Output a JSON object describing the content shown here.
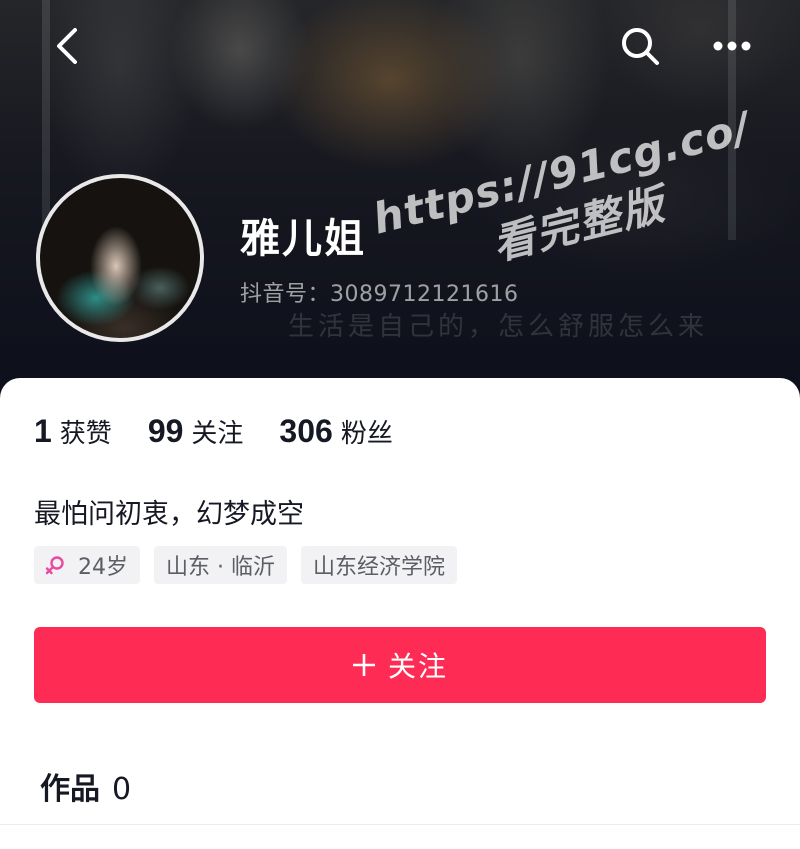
{
  "header": {
    "icons": {
      "back": "chevron-left-icon",
      "search": "search-icon",
      "more": "more-dots-icon"
    }
  },
  "profile": {
    "nickname": "雅儿姐",
    "douyin_id": "抖音号：3089712121616",
    "faded_signature": "生活是自己的，怎么舒服怎么来"
  },
  "watermark": {
    "line1": "https://91cg.co/",
    "line2": "看完整版"
  },
  "stats": [
    {
      "num": "1",
      "label": "获赞"
    },
    {
      "num": "99",
      "label": "关注"
    },
    {
      "num": "306",
      "label": "粉丝"
    }
  ],
  "bio": "最怕问初衷，幻梦成空",
  "tags": {
    "age": "24岁",
    "location": "山东 · 临沂",
    "school": "山东经济学院"
  },
  "follow_button": {
    "label": "关注",
    "color": "#fe2c55"
  },
  "works_tab": {
    "label": "作品",
    "count": "0"
  },
  "colors": {
    "accent": "#fe2c55",
    "gender_female": "#e94aa0"
  }
}
